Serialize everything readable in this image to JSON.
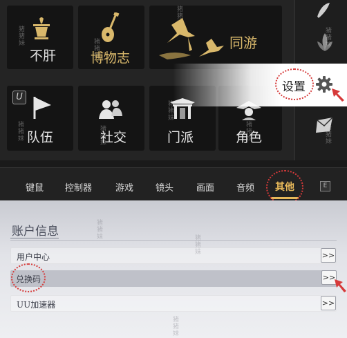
{
  "menu": {
    "tiles": [
      {
        "id": "bugan",
        "label": "不肝"
      },
      {
        "id": "museum",
        "label": "博物志"
      },
      {
        "id": "together",
        "label": "同游"
      },
      {
        "id": "team",
        "label": "队伍"
      },
      {
        "id": "social",
        "label": "社交"
      },
      {
        "id": "sect",
        "label": "门派"
      },
      {
        "id": "character",
        "label": "角色"
      }
    ],
    "badge_u": "U",
    "watermark": "猪猪妹",
    "settings_label": "设置"
  },
  "tabs": {
    "items": [
      "键鼠",
      "控制器",
      "游戏",
      "镜头",
      "画面",
      "音频",
      "其他"
    ],
    "active": "其他",
    "extra_badge": "E"
  },
  "account": {
    "section_title": "账户信息",
    "rows": [
      {
        "label": "用户中心",
        "button": ">>"
      },
      {
        "label": "兑换码",
        "button": ">>"
      },
      {
        "label": "UU加速器",
        "button": ">>"
      }
    ]
  },
  "colors": {
    "accent_gold": "#e6b85a",
    "annotation_red": "#d63a3a"
  },
  "icons": [
    "tea-bowl-icon",
    "pipa-icon",
    "cranes-icon",
    "flag-icon",
    "people-icon",
    "gate-icon",
    "character-icon",
    "gear-icon"
  ]
}
